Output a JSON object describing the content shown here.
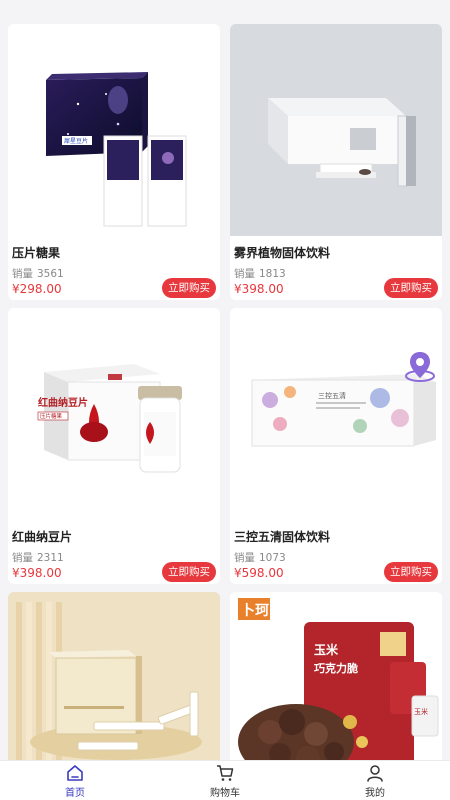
{
  "products": [
    {
      "name": "压片糖果",
      "sales_label": "销量",
      "sales": "3561",
      "price": "¥298.00",
      "buy_label": "立即购买"
    },
    {
      "name": "雾界植物固体饮料",
      "sales_label": "销量",
      "sales": "1813",
      "price": "¥398.00",
      "buy_label": "立即购买"
    },
    {
      "name": "红曲纳豆片",
      "sales_label": "销量",
      "sales": "2311",
      "price": "¥398.00",
      "buy_label": "立即购买"
    },
    {
      "name": "三控五清固体饮料",
      "sales_label": "销量",
      "sales": "1073",
      "price": "¥598.00",
      "buy_label": "立即购买"
    }
  ],
  "image_text": {
    "p1_brand": "犀星豆片",
    "p3_title": "红曲纳豆片",
    "p3_sub": "压片糖果",
    "p4_title": "三控五清",
    "p6_logo": "卜珂",
    "p6_line1": "玉米",
    "p6_line2": "巧克力脆",
    "p6_small": "玉米"
  },
  "tabbar": {
    "items": [
      {
        "label": "首页",
        "icon": "home-icon",
        "active": true
      },
      {
        "label": "购物车",
        "icon": "cart-icon",
        "active": false
      },
      {
        "label": "我的",
        "icon": "user-icon",
        "active": false
      }
    ]
  },
  "colors": {
    "accent": "#e6383d",
    "active_tab": "#3a3ac0",
    "background": "#f4f4f6"
  }
}
